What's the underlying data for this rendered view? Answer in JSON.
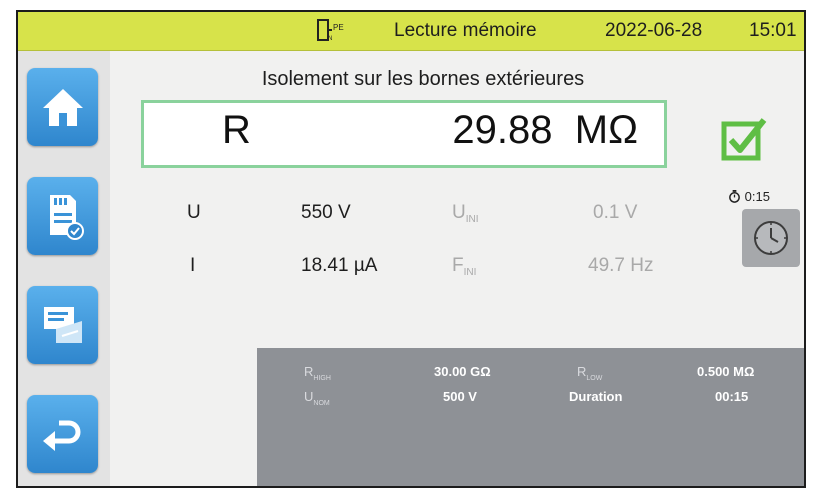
{
  "topbar": {
    "mode_label": "Lecture mémoire",
    "date": "2022-06-28",
    "time": "15:01",
    "status_icon": "pin-ps-icon",
    "status_tag": "PE"
  },
  "sidebar": {
    "items": [
      {
        "name": "home",
        "icon": "home-icon"
      },
      {
        "name": "memory-card",
        "icon": "sd-card-check-icon"
      },
      {
        "name": "report",
        "icon": "report-icon"
      },
      {
        "name": "back",
        "icon": "back-arrow-icon"
      }
    ]
  },
  "measurement": {
    "title": "Isolement sur les bornes extérieures",
    "result_label": "R",
    "result_value": "29.88",
    "result_unit": "MΩ",
    "status": "pass"
  },
  "readings": {
    "u_label": "U",
    "u_value": "550 V",
    "uini_main": "U",
    "uini_sub": "INI",
    "uini_value": "0.1 V",
    "i_label": "I",
    "i_value": "18.41 µA",
    "fini_main": "F",
    "fini_sub": "INI",
    "fini_value": "49.7 Hz"
  },
  "timer": {
    "value": "0:15"
  },
  "params": {
    "rhigh_main": "R",
    "rhigh_sub": "HIGH",
    "rhigh_value": "30.00 GΩ",
    "rlow_main": "R",
    "rlow_sub": "LOW",
    "rlow_value": "0.500 MΩ",
    "unom_main": "U",
    "unom_sub": "NOM",
    "unom_value": "500 V",
    "duration_label": "Duration",
    "duration_value": "00:15"
  },
  "colors": {
    "topbar": "#d7e34a",
    "button_blue": "#3a93d8",
    "result_border": "#8ad29c",
    "check_green": "#5fbe45",
    "panel": "#8e9196"
  }
}
